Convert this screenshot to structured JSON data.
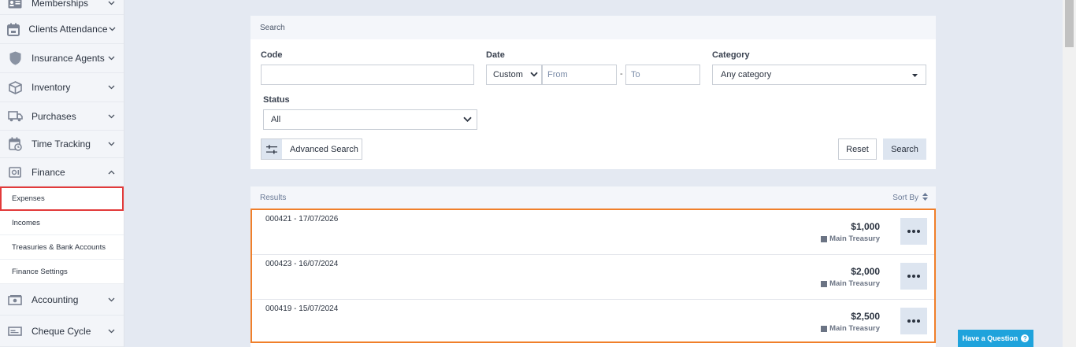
{
  "sidebar": {
    "items": [
      {
        "label": "Memberships",
        "icon": "membership-card-icon"
      },
      {
        "label": "Clients Attendance",
        "icon": "calendar-icon"
      },
      {
        "label": "Insurance Agents",
        "icon": "shield-icon"
      },
      {
        "label": "Inventory",
        "icon": "box-icon"
      },
      {
        "label": "Purchases",
        "icon": "truck-icon"
      },
      {
        "label": "Time Tracking",
        "icon": "clock-calendar-icon"
      },
      {
        "label": "Finance",
        "icon": "safe-icon"
      },
      {
        "label": "Accounting",
        "icon": "money-icon"
      },
      {
        "label": "Cheque Cycle",
        "icon": "cheque-icon"
      }
    ],
    "finance_sub": [
      "Expenses",
      "Incomes",
      "Treasuries & Bank Accounts",
      "Finance Settings"
    ]
  },
  "search": {
    "title": "Search",
    "code_label": "Code",
    "date_label": "Date",
    "date_mode": "Custom",
    "from_placeholder": "From",
    "to_placeholder": "To",
    "category_label": "Category",
    "category_value": "Any category",
    "status_label": "Status",
    "status_value": "All",
    "advanced_label": "Advanced Search",
    "reset_label": "Reset",
    "search_label": "Search"
  },
  "results": {
    "title": "Results",
    "sort_label": "Sort By",
    "rows": [
      {
        "code": "000421 - 17/07/2026",
        "amount": "$1,000",
        "treasury": "Main Treasury"
      },
      {
        "code": "000423 - 16/07/2024",
        "amount": "$2,000",
        "treasury": "Main Treasury"
      },
      {
        "code": "000419 - 15/07/2024",
        "amount": "$2,500",
        "treasury": "Main Treasury"
      }
    ]
  },
  "help": {
    "label": "Have a Question"
  },
  "colors": {
    "highlight_red": "#e23a3a",
    "highlight_orange": "#f07f2a",
    "help_blue": "#1fa3dc"
  }
}
